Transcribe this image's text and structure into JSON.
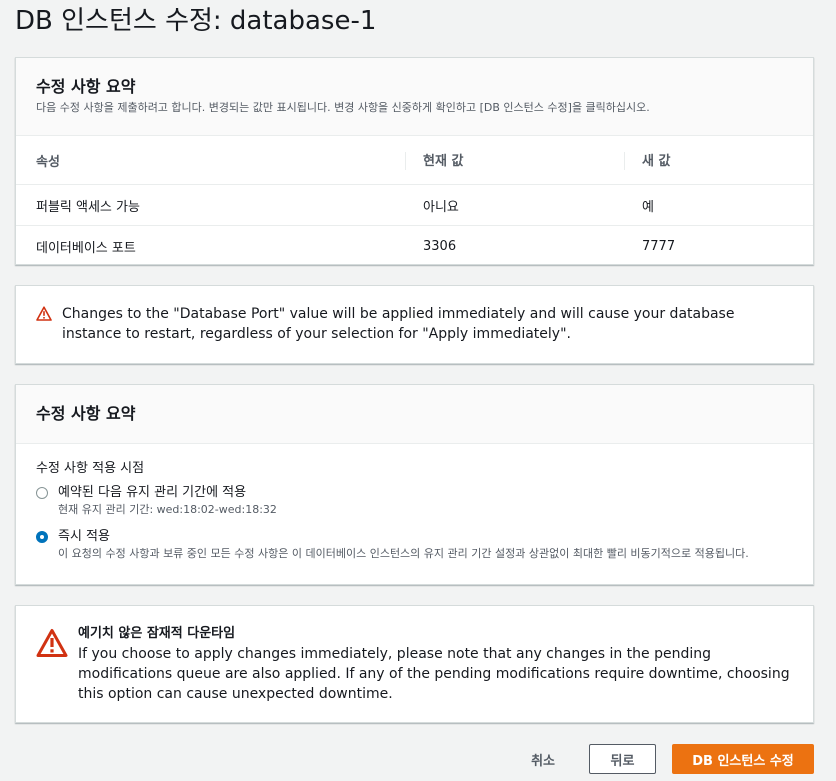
{
  "page": {
    "title": "DB 인스턴스 수정: database-1"
  },
  "summary": {
    "title": "수정 사항 요약",
    "description": "다음 수정 사항을 제출하려고 합니다. 변경되는 값만 표시됩니다. 변경 사항을 신중하게 확인하고 [DB 인스턴스 수정]을 클릭하십시오.",
    "columns": [
      "속성",
      "현재 값",
      "새 값"
    ],
    "rows": [
      {
        "attribute": "퍼블릭 액세스 가능",
        "current": "아니요",
        "new": "예"
      },
      {
        "attribute": "데이터베이스 포트",
        "current": "3306",
        "new": "7777"
      }
    ]
  },
  "port_warning": {
    "icon": "warning-icon",
    "text": "Changes to the \"Database Port\" value will be applied immediately and will cause your database instance to restart, regardless of your selection for \"Apply immediately\"."
  },
  "schedule": {
    "title": "수정 사항 요약",
    "field_label": "수정 사항 적용 시점",
    "options": [
      {
        "label": "예약된 다음 유지 관리 기간에 적용",
        "description": "현재 유지 관리 기간: wed:18:02-wed:18:32",
        "selected": false
      },
      {
        "label": "즉시 적용",
        "description": "이 요청의 수정 사항과 보류 중인 모든 수정 사항은 이 데이터베이스 인스턴스의 유지 관리 기간 설정과 상관없이 최대한 빨리 비동기적으로 적용됩니다.",
        "selected": true
      }
    ]
  },
  "downtime_warning": {
    "icon": "warning-icon",
    "title": "예기치 않은 잠재적 다운타임",
    "text": "If you choose to apply changes immediately, please note that any changes in the pending modifications queue are also applied. If any of the pending modifications require downtime, choosing this option can cause unexpected downtime."
  },
  "footer": {
    "cancel_label": "취소",
    "back_label": "뒤로",
    "submit_label": "DB 인스턴스 수정"
  },
  "colors": {
    "primary_button": "#ec7211",
    "warning_red": "#d13212",
    "radio_selected": "#0073bb"
  }
}
